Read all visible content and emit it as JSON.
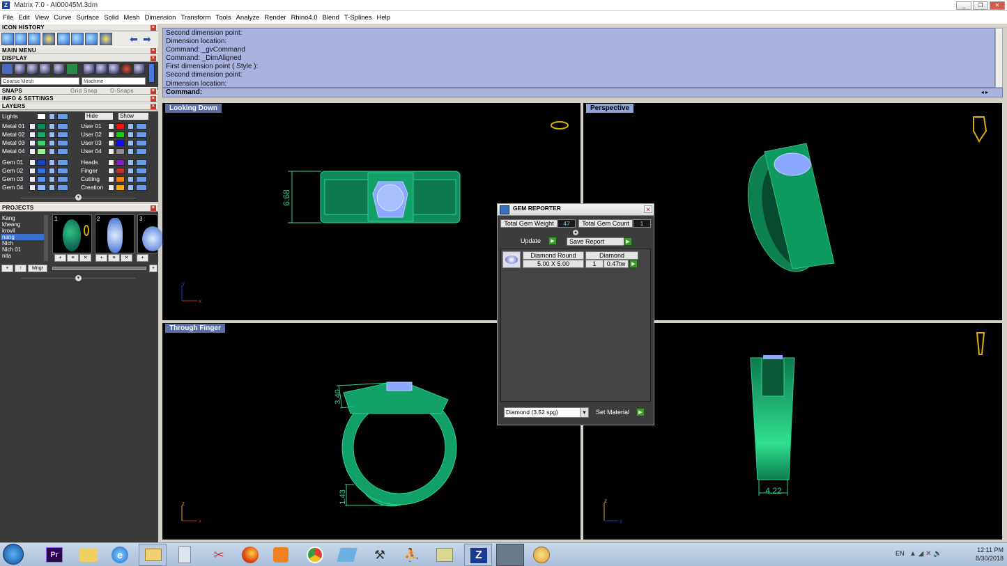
{
  "window": {
    "title": "Matrix 7.0 - AI00045M.3dm",
    "controls": [
      "_",
      "❐",
      "✕"
    ]
  },
  "menu": [
    "File",
    "Edit",
    "View",
    "Curve",
    "Surface",
    "Solid",
    "Mesh",
    "Dimension",
    "Transform",
    "Tools",
    "Analyze",
    "Render",
    "Rhino4.0",
    "Blend",
    "T-Splines",
    "Help"
  ],
  "panel": {
    "icon_history": "ICON HISTORY",
    "main_menu": "MAIN MENU",
    "display": "DISPLAY",
    "mesh_select": "Coarse Mesh",
    "material_select": "Machine",
    "snaps": "SNAPS",
    "grid_snap": "Grid Snap",
    "o_snaps": "O-Snaps",
    "info_settings": "INFO & SETTINGS",
    "layers": "LAYERS",
    "lights": "Lights",
    "hide": "Hide",
    "show": "Show",
    "projects": "PROJECTS",
    "mngr": "Mngr"
  },
  "layers_left": [
    {
      "name": "Metal 01",
      "color": "#0c8a5a"
    },
    {
      "name": "Metal 02",
      "color": "#1aaa6a"
    },
    {
      "name": "Metal 03",
      "color": "#40d070"
    },
    {
      "name": "Metal 04",
      "color": "#a0f0a0"
    },
    {
      "name": "Gem 01",
      "color": "#1a40c0"
    },
    {
      "name": "Gem 02",
      "color": "#3a70e0"
    },
    {
      "name": "Gem 03",
      "color": "#5a90f0"
    },
    {
      "name": "Gem 04",
      "color": "#90b8ff"
    }
  ],
  "layers_right": [
    {
      "name": "User 01",
      "color": "#ff1010"
    },
    {
      "name": "User 02",
      "color": "#10d010"
    },
    {
      "name": "User 03",
      "color": "#1010ff"
    },
    {
      "name": "User 04",
      "color": "#909090"
    },
    {
      "name": "Heads",
      "color": "#8020c0"
    },
    {
      "name": "Finger",
      "color": "#c03030"
    },
    {
      "name": "Cutting",
      "color": "#ff8000"
    },
    {
      "name": "Creation",
      "color": "#ffb000"
    }
  ],
  "projects_list": [
    "Kang",
    "kheang",
    "krovil",
    "nang",
    "Nich",
    "Nich 01",
    "nita"
  ],
  "projects_selected": "nang",
  "project_thumbs": [
    "1",
    "2",
    "3"
  ],
  "command_history": [
    "Second dimension point:",
    "Dimension location:",
    "Command: _gvCommand",
    "Command: _DimAligned",
    "First dimension point ( Style ):",
    "Second dimension point:",
    "Dimension location:"
  ],
  "command_prompt": "Command:",
  "viewports": {
    "top_left": "Looking Down",
    "top_right": "Perspective",
    "bottom_left": "Through Finger",
    "bottom_right": ""
  },
  "dimensions": {
    "width": "6.68",
    "top": "3.40",
    "bottom": "1.43",
    "side": "4.22"
  },
  "axes": {
    "top_y": "y",
    "top_x": "x",
    "front_z": "z",
    "front_x": "x",
    "side_z": "z",
    "side_y": "y"
  },
  "gem_reporter": {
    "title": "GEM REPORTER",
    "total_weight_label": "Total Gem Weight",
    "total_weight": "47",
    "total_count_label": "Total Gem Count",
    "total_count": "1",
    "update": "Update",
    "save_report": "Save Report",
    "item_name": "Diamond Round",
    "item_size": "5.00 X 5.00",
    "item_material": "Diamond",
    "item_count": "1",
    "item_weight": "0.47tw",
    "material_select": "Diamond     (3.52 spg)",
    "set_material": "Set Material"
  },
  "tray": {
    "lang": "EN",
    "time": "12:11 PM",
    "date": "8/30/2018"
  },
  "taskbar_apps": [
    "start-orb",
    "premiere-icon",
    "explorer-folder-icon",
    "ie-icon",
    "file-manager-icon",
    "calculator-icon",
    "snipping-icon",
    "firefox-icon",
    "media-player-icon",
    "chrome-icon",
    "sketch-icon",
    "tool-icon",
    "zbrush-icon",
    "notes-icon",
    "matrix-icon",
    "rhino-icon",
    "paint-icon"
  ]
}
